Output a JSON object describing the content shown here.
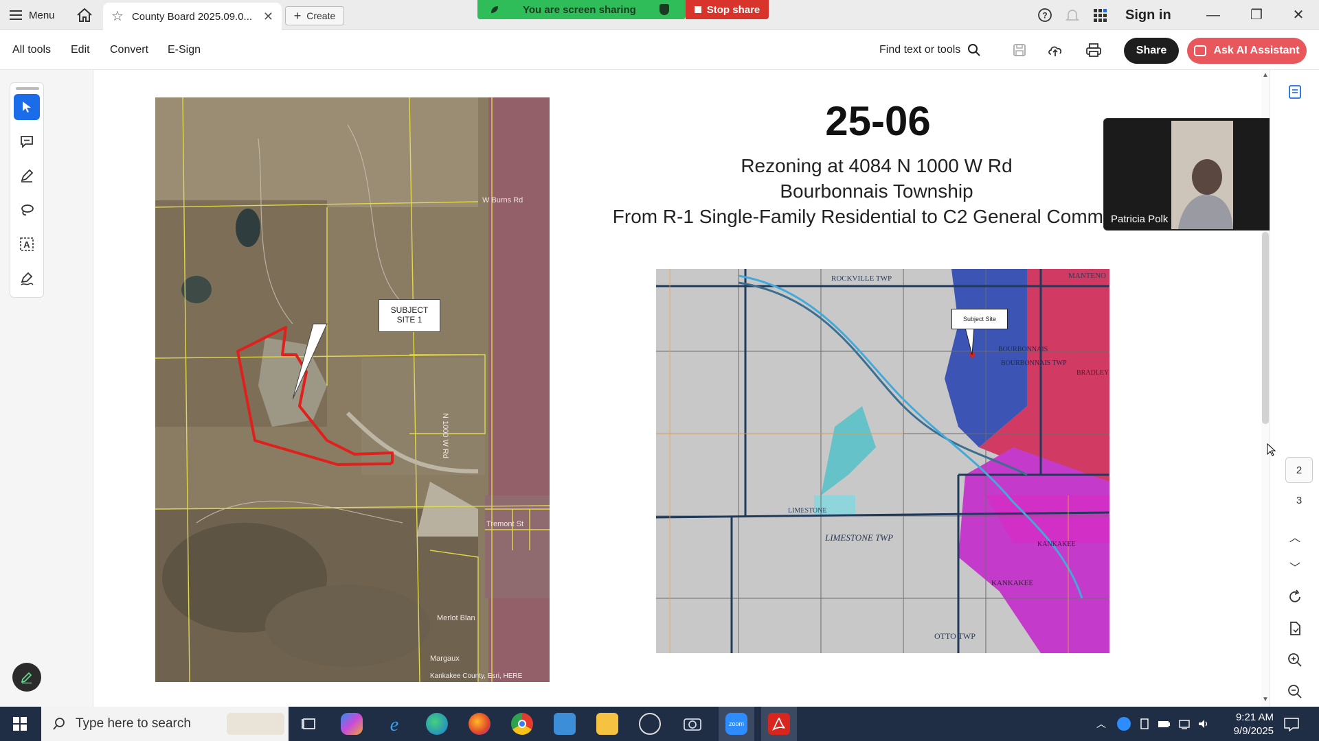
{
  "tabbar": {
    "menu_label": "Menu",
    "doc_tab_title": "County Board 2025.09.0...",
    "create_label": "Create",
    "sharing_text": "You are screen sharing",
    "stop_share_label": "Stop share",
    "signin_label": "Sign in"
  },
  "toolbar": {
    "items": [
      "All tools",
      "Edit",
      "Convert",
      "E-Sign"
    ],
    "find_label": "Find text or tools",
    "share_label": "Share",
    "ai_label": "Ask AI Assistant"
  },
  "slide": {
    "number": "25-06",
    "line1": "Rezoning at 4084 N 1000 W Rd",
    "line2": "Bourbonnais Township",
    "line3": "From R-1 Single-Family Residential to C2 General Comm",
    "aerial": {
      "callout": [
        "SUBJECT",
        "SITE 1"
      ],
      "road_burns": "W Burns Rd",
      "road_tremont": "Tremont St",
      "road_merlot": "Merlot Blan",
      "road_margaux": "Margaux",
      "road_vertical": "N 1000 W Rd",
      "credit": "Kankakee County, Esri, HERE"
    },
    "zoning_map": {
      "callout": "Subject Site",
      "labels": [
        "ROCKVILLE TWP",
        "MANTENO",
        "BOURBONNAIS",
        "BOURBONNAIS TWP",
        "BRADLEY",
        "LIMESTONE",
        "LIMESTONE TWP",
        "KANKAKEE",
        "OTTO TWP",
        "KANKAKEE"
      ]
    }
  },
  "video": {
    "participant": "Patricia Polk"
  },
  "right_rail": {
    "pages": [
      "2",
      "3"
    ]
  },
  "taskbar": {
    "search_placeholder": "Type here to search",
    "time": "9:21 AM",
    "date": "9/9/2025"
  },
  "colors": {
    "accent_blue": "#1a6ce8",
    "ai_red": "#e8575c",
    "share_green": "#2ebd59",
    "stop_red": "#d9342b",
    "site_outline": "#e0201c",
    "taskbar": "#1f2e44"
  }
}
